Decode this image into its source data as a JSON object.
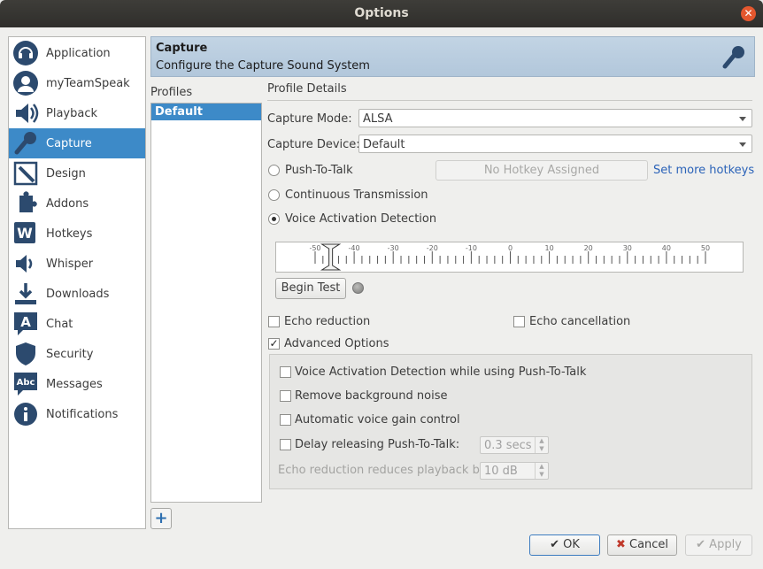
{
  "window": {
    "title": "Options"
  },
  "sidebar": {
    "items": [
      {
        "label": "Application",
        "icon": "headset-icon"
      },
      {
        "label": "myTeamSpeak",
        "icon": "user-icon"
      },
      {
        "label": "Playback",
        "icon": "speaker-icon"
      },
      {
        "label": "Capture",
        "icon": "microphone-icon",
        "selected": true
      },
      {
        "label": "Design",
        "icon": "design-icon"
      },
      {
        "label": "Addons",
        "icon": "puzzle-icon"
      },
      {
        "label": "Hotkeys",
        "icon": "keyboard-w-icon"
      },
      {
        "label": "Whisper",
        "icon": "whisper-icon"
      },
      {
        "label": "Downloads",
        "icon": "download-icon"
      },
      {
        "label": "Chat",
        "icon": "chat-icon"
      },
      {
        "label": "Security",
        "icon": "shield-icon"
      },
      {
        "label": "Messages",
        "icon": "messages-icon"
      },
      {
        "label": "Notifications",
        "icon": "info-icon"
      }
    ]
  },
  "header": {
    "title": "Capture",
    "subtitle": "Configure the Capture Sound System"
  },
  "profiles": {
    "label": "Profiles",
    "items": [
      "Default"
    ],
    "add_label": "+"
  },
  "details": {
    "title": "Profile Details",
    "capture_mode_label": "Capture Mode:",
    "capture_mode_value": "ALSA",
    "capture_device_label": "Capture Device:",
    "capture_device_value": "Default",
    "ptt_label": "Push-To-Talk",
    "hotkey_button": "No Hotkey Assigned",
    "more_hotkeys": "Set more hotkeys",
    "continuous_label": "Continuous Transmission",
    "vad_label": "Voice Activation Detection",
    "meter_ticks": [
      "-50",
      "-40",
      "-30",
      "-20",
      "-10",
      "0",
      "10",
      "20",
      "30",
      "40",
      "50"
    ],
    "meter_threshold": -46,
    "begin_test": "Begin Test",
    "echo_reduction": "Echo reduction",
    "echo_cancellation": "Echo cancellation",
    "advanced_options": "Advanced Options",
    "advanced_checked": true,
    "adv_vad_ptt": "Voice Activation Detection while using Push-To-Talk",
    "adv_remove_noise": "Remove background noise",
    "adv_agc": "Automatic voice gain control",
    "adv_delay_label": "Delay releasing Push-To-Talk:",
    "adv_delay_value": "0.3 secs",
    "adv_echo_reduce_label": "Echo reduction reduces playback by:",
    "adv_echo_reduce_value": "10 dB"
  },
  "footer": {
    "ok": "OK",
    "cancel": "Cancel",
    "apply": "Apply"
  }
}
